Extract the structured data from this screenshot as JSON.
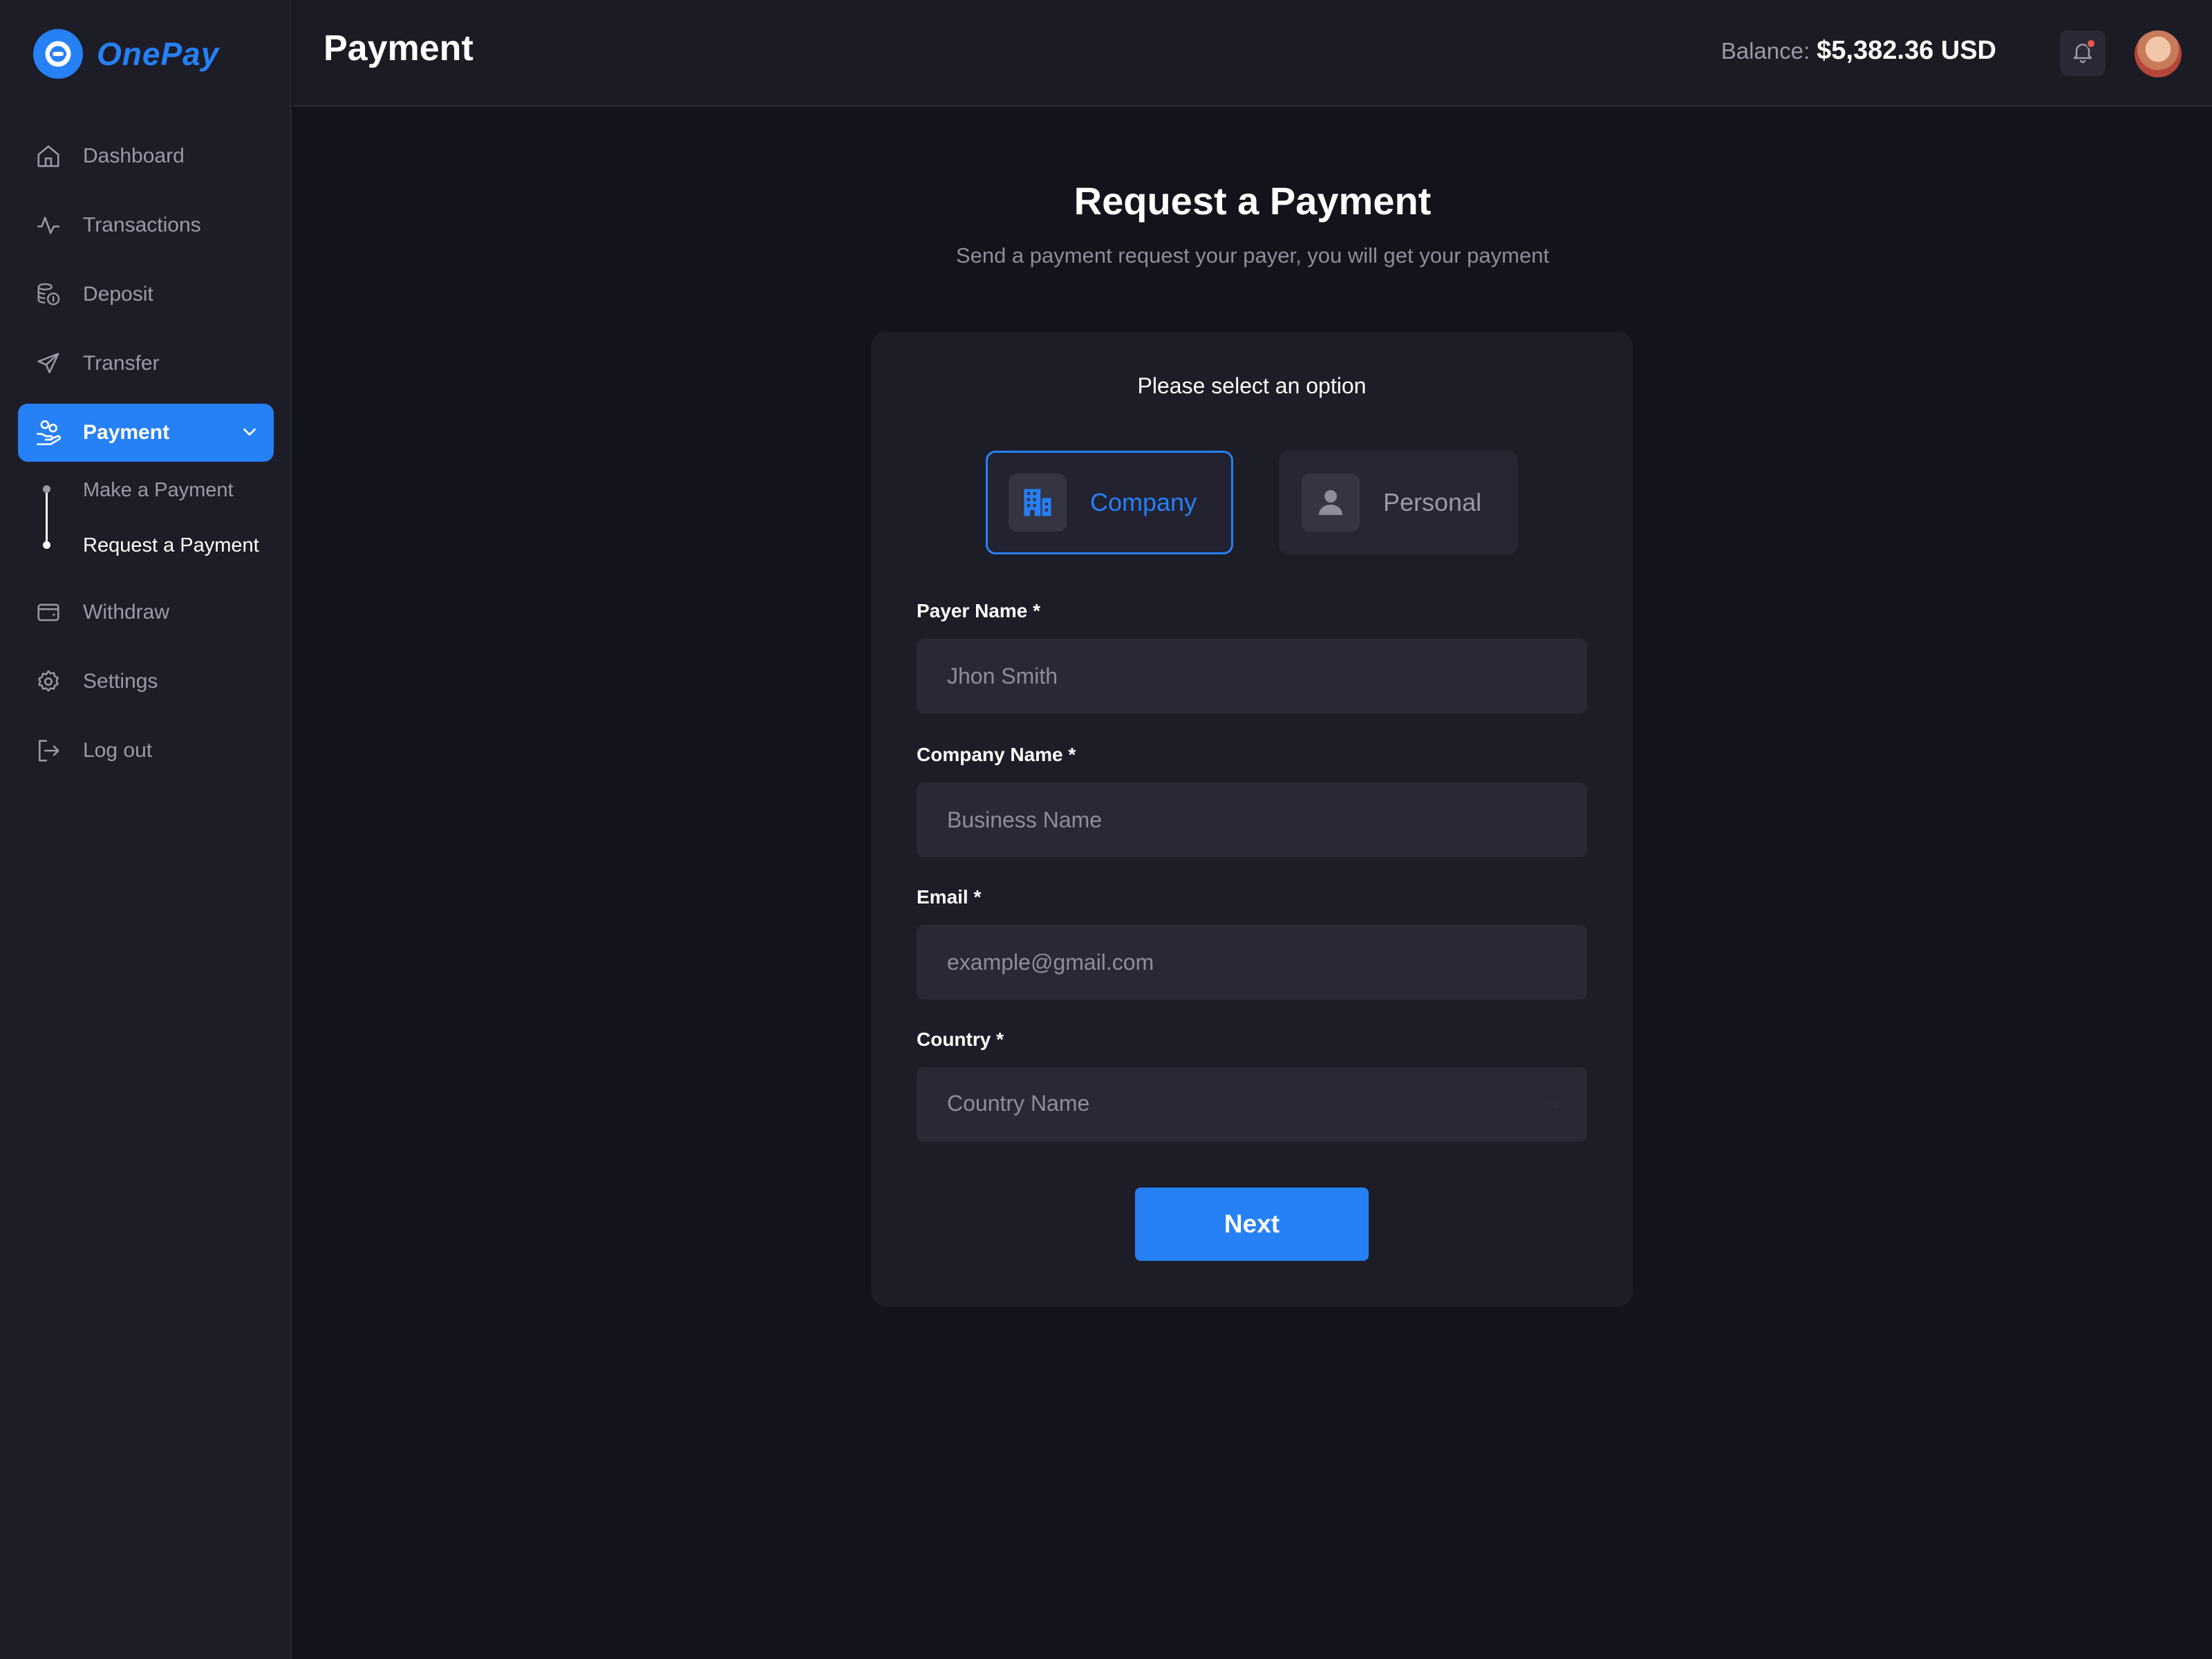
{
  "app": {
    "name": "OnePay",
    "brand_color": "#2680f6"
  },
  "sidebar": {
    "items": [
      {
        "label": "Dashboard",
        "icon": "home-icon"
      },
      {
        "label": "Transactions",
        "icon": "activity-icon"
      },
      {
        "label": "Deposit",
        "icon": "coins-icon"
      },
      {
        "label": "Transfer",
        "icon": "send-icon"
      },
      {
        "label": "Payment",
        "icon": "hand-coins-icon",
        "active": true,
        "expanded": true
      },
      {
        "label": "Withdraw",
        "icon": "wallet-icon"
      },
      {
        "label": "Settings",
        "icon": "gear-icon"
      },
      {
        "label": "Log out",
        "icon": "logout-icon"
      }
    ],
    "payment_subitems": [
      {
        "label": "Make a Payment"
      },
      {
        "label": "Request a Payment",
        "active": true
      }
    ]
  },
  "header": {
    "title": "Payment",
    "balance_label": "Balance:",
    "balance_value": "$5,382.36 USD"
  },
  "main": {
    "title": "Request a Payment",
    "subtitle": "Send a payment request your payer, you will get your payment",
    "select_label": "Please select an option",
    "options": [
      {
        "label": "Company",
        "icon": "building-icon",
        "selected": true
      },
      {
        "label": "Personal",
        "icon": "user-icon",
        "selected": false
      }
    ],
    "fields": {
      "payer_name": {
        "label": "Payer Name *",
        "placeholder": "Jhon Smith",
        "value": ""
      },
      "company_name": {
        "label": "Company Name *",
        "placeholder": "Business Name",
        "value": ""
      },
      "email": {
        "label": "Email *",
        "placeholder": "example@gmail.com",
        "value": ""
      },
      "country": {
        "label": "Country *",
        "placeholder": "Country Name",
        "value": ""
      }
    },
    "next_label": "Next"
  }
}
